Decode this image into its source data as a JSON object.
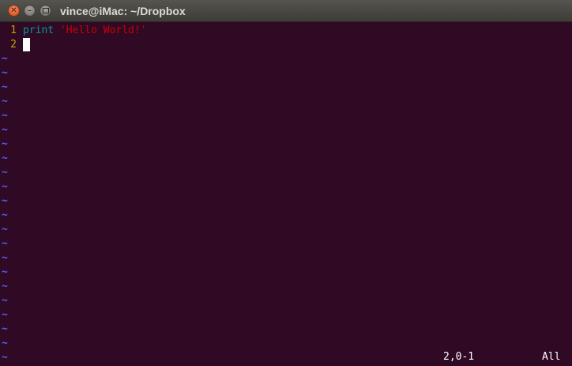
{
  "window": {
    "title": "vince@iMac: ~/Dropbox",
    "close_symbol": "✕",
    "minimize_symbol": "–"
  },
  "editor": {
    "lines": [
      {
        "number": "1",
        "keyword": "print",
        "string": "'Hello World!'"
      },
      {
        "number": "2"
      }
    ],
    "empty_line_marker": "~"
  },
  "statusline": {
    "position": "2,0-1",
    "scroll": "All"
  },
  "colors": {
    "background": "#300a24",
    "line_number": "#c4a000",
    "keyword": "#06989a",
    "string": "#cc0000",
    "tilde": "#5a5aff"
  }
}
